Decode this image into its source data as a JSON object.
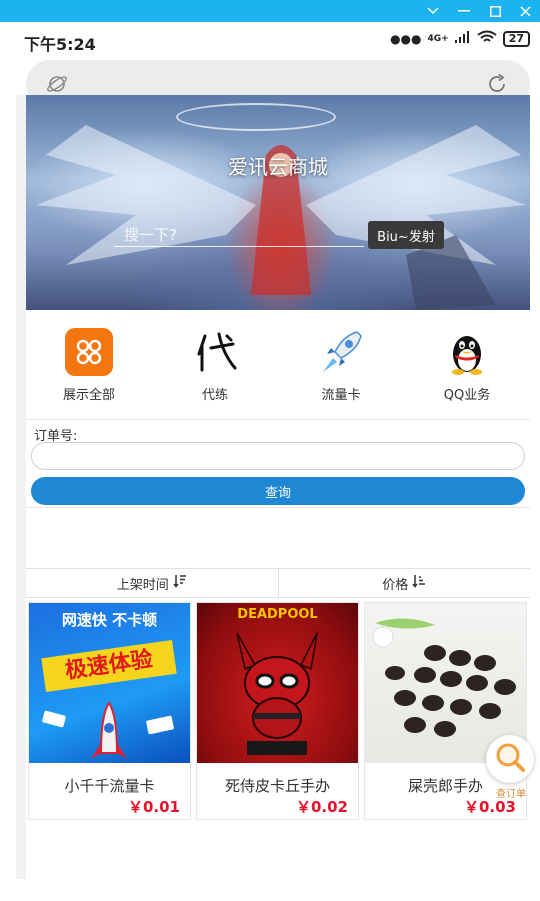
{
  "window": {
    "controls": [
      "chevron-down-icon",
      "minimize-icon",
      "maximize-icon",
      "close-icon"
    ],
    "accent": "#1bb4f0"
  },
  "status_bar": {
    "time": "下午5:24",
    "network": "4G+",
    "battery": "27"
  },
  "banner": {
    "title": "爱讯云商城",
    "search_placeholder": "搜一下?",
    "search_button": "Biu~发射"
  },
  "categories": [
    {
      "label": "展示全部",
      "icon": "grid-icon"
    },
    {
      "label": "代练",
      "icon": "dai-calligraphy-icon"
    },
    {
      "label": "流量卡",
      "icon": "rocket-icon"
    },
    {
      "label": "QQ业务",
      "icon": "qq-penguin-icon"
    }
  ],
  "order_query": {
    "label": "订单号:",
    "input_value": "",
    "button": "查询",
    "button_color": "#1e88d4"
  },
  "sort": {
    "by_time": "上架时间",
    "by_price": "价格"
  },
  "products": [
    {
      "name": "小千千流量卡",
      "price": "￥0.01",
      "image_text_1": "网速快 不卡顿",
      "image_text_2": "极速体验"
    },
    {
      "name": "死侍皮卡丘手办",
      "price": "￥0.02",
      "image_text_1": "DEADPOOL"
    },
    {
      "name": "屎壳郎手办",
      "price": "￥0.03"
    }
  ],
  "float_button": {
    "label": "查订单"
  },
  "price_color": "#e4122a"
}
